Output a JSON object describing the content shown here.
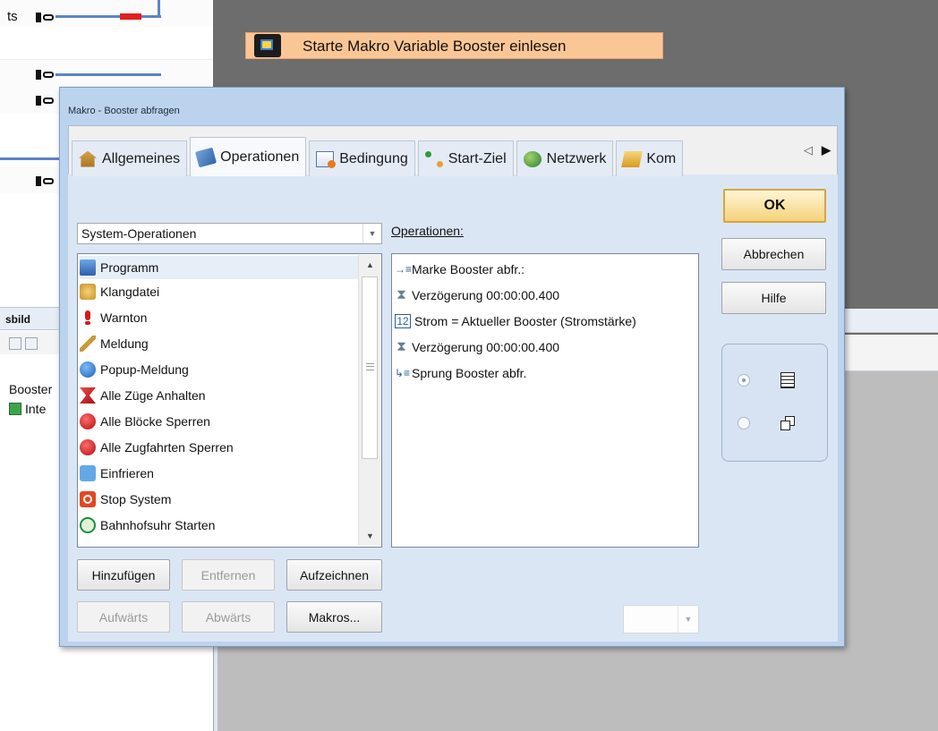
{
  "background": {
    "top_label": "ts",
    "macro_banner_text": "Starte Makro Variable Booster einlesen",
    "panel_title": "sbild",
    "tree_item_1": "Booster",
    "tree_item_2": "Inte"
  },
  "dialog": {
    "title": "Makro - Booster abfragen",
    "tabs": [
      {
        "label": "Allgemeines",
        "icon": "home-icon"
      },
      {
        "label": "Operationen",
        "icon": "operations-icon"
      },
      {
        "label": "Bedingung",
        "icon": "condition-icon"
      },
      {
        "label": "Start-Ziel",
        "icon": "start-target-icon"
      },
      {
        "label": "Netzwerk",
        "icon": "network-icon"
      },
      {
        "label": "Kom",
        "icon": "comment-icon"
      }
    ],
    "active_tab": "Operationen",
    "category_combo": "System-Operationen",
    "operations_label": "Operationen:",
    "system_operations": [
      {
        "label": "Programm",
        "icon": "program-icon"
      },
      {
        "label": "Klangdatei",
        "icon": "sound-file-icon"
      },
      {
        "label": "Warnton",
        "icon": "warning-tone-icon"
      },
      {
        "label": "Meldung",
        "icon": "message-icon"
      },
      {
        "label": "Popup-Meldung",
        "icon": "popup-message-icon"
      },
      {
        "label": "Alle Züge Anhalten",
        "icon": "stop-trains-icon"
      },
      {
        "label": "Alle Blöcke Sperren",
        "icon": "lock-blocks-icon"
      },
      {
        "label": "Alle Zugfahrten Sperren",
        "icon": "lock-routes-icon"
      },
      {
        "label": "Einfrieren",
        "icon": "freeze-icon"
      },
      {
        "label": "Stop System",
        "icon": "stop-system-icon"
      },
      {
        "label": "Bahnhofsuhr Starten",
        "icon": "station-clock-icon"
      }
    ],
    "operations": [
      {
        "label": "Marke Booster abfr.:",
        "icon": "label-marker-icon"
      },
      {
        "label": "Verzögerung 00:00:00.400",
        "icon": "hourglass-icon"
      },
      {
        "label": "Strom = Aktueller Booster (Stromstärke)",
        "icon": "number-variable-icon"
      },
      {
        "label": "Verzögerung 00:00:00.400",
        "icon": "hourglass-icon"
      },
      {
        "label": "Sprung Booster abfr.",
        "icon": "jump-icon"
      }
    ],
    "buttons": {
      "hinzufuegen": "Hinzufügen",
      "entfernen": "Entfernen",
      "aufzeichnen": "Aufzeichnen",
      "aufwaerts": "Aufwärts",
      "abwaerts": "Abwärts",
      "makros": "Makros...",
      "ok": "OK",
      "abbrechen": "Abbrechen",
      "hilfe": "Hilfe"
    }
  }
}
